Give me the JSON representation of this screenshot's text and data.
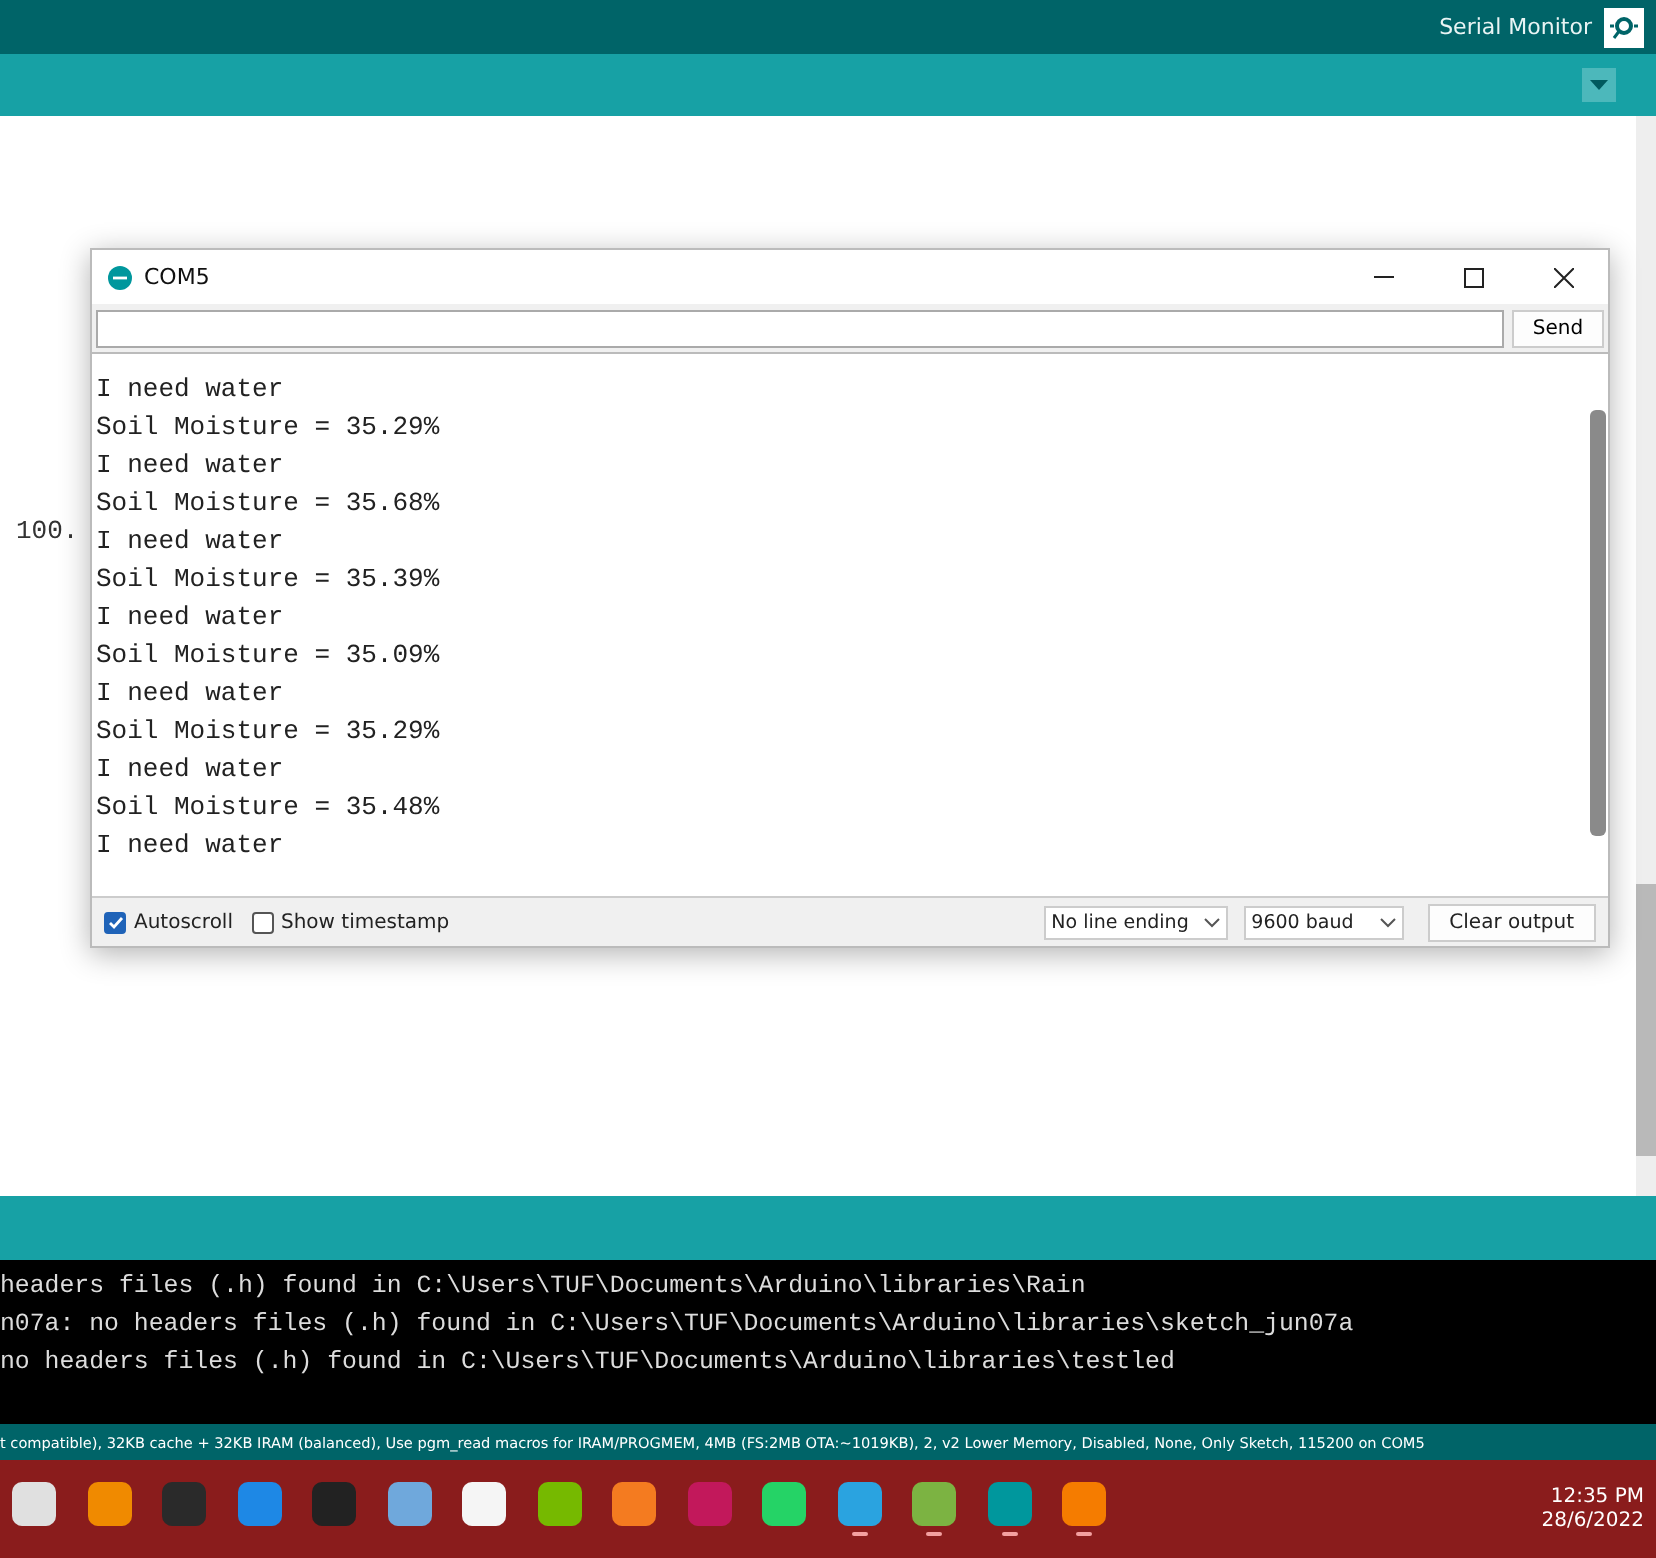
{
  "header": {
    "title": "Serial Monitor"
  },
  "editor": {
    "fragment": "100."
  },
  "serial_window": {
    "title": "COM5",
    "send_label": "Send",
    "lines": [
      "I need water",
      "Soil Moisture = 35.29%",
      "I need water",
      "Soil Moisture = 35.68%",
      "I need water",
      "Soil Moisture = 35.39%",
      "I need water",
      "Soil Moisture = 35.09%",
      "I need water",
      "Soil Moisture = 35.29%",
      "I need water",
      "Soil Moisture = 35.48%",
      "I need water"
    ],
    "autoscroll": {
      "label": "Autoscroll",
      "checked": true
    },
    "timestamp": {
      "label": "Show timestamp",
      "checked": false
    },
    "line_ending": "No line ending",
    "baud": "9600 baud",
    "clear_label": "Clear output"
  },
  "console": {
    "lines": [
      "headers files (.h) found in C:\\Users\\TUF\\Documents\\Arduino\\libraries\\Rain",
      "n07a: no headers files (.h) found in C:\\Users\\TUF\\Documents\\Arduino\\libraries\\sketch_jun07a",
      "no headers files (.h) found in C:\\Users\\TUF\\Documents\\Arduino\\libraries\\testled"
    ]
  },
  "status_bar": "t compatible), 32KB cache + 32KB IRAM (balanced), Use pgm_read macros for IRAM/PROGMEM, 4MB (FS:2MB OTA:~1019KB), 2, v2 Lower Memory, Disabled, None, Only Sketch, 115200 on COM5",
  "taskbar": {
    "apps": [
      {
        "color": "#e0e0e0",
        "running": false
      },
      {
        "color": "#f08a00",
        "running": false
      },
      {
        "color": "#2a2a2a",
        "running": false
      },
      {
        "color": "#1e88e5",
        "running": false
      },
      {
        "color": "#222222",
        "running": false
      },
      {
        "color": "#6fa8dc",
        "running": false
      },
      {
        "color": "#f5f5f5",
        "running": false
      },
      {
        "color": "#76b900",
        "running": false
      },
      {
        "color": "#f47b20",
        "running": false
      },
      {
        "color": "#c2185b",
        "running": false
      },
      {
        "color": "#25d366",
        "running": false
      },
      {
        "color": "#2aa3e0",
        "running": true
      },
      {
        "color": "#7cb342",
        "running": true
      },
      {
        "color": "#00979d",
        "running": true
      },
      {
        "color": "#f57c00",
        "running": true
      }
    ],
    "time": "12:35 PM",
    "date": "28/6/2022"
  }
}
